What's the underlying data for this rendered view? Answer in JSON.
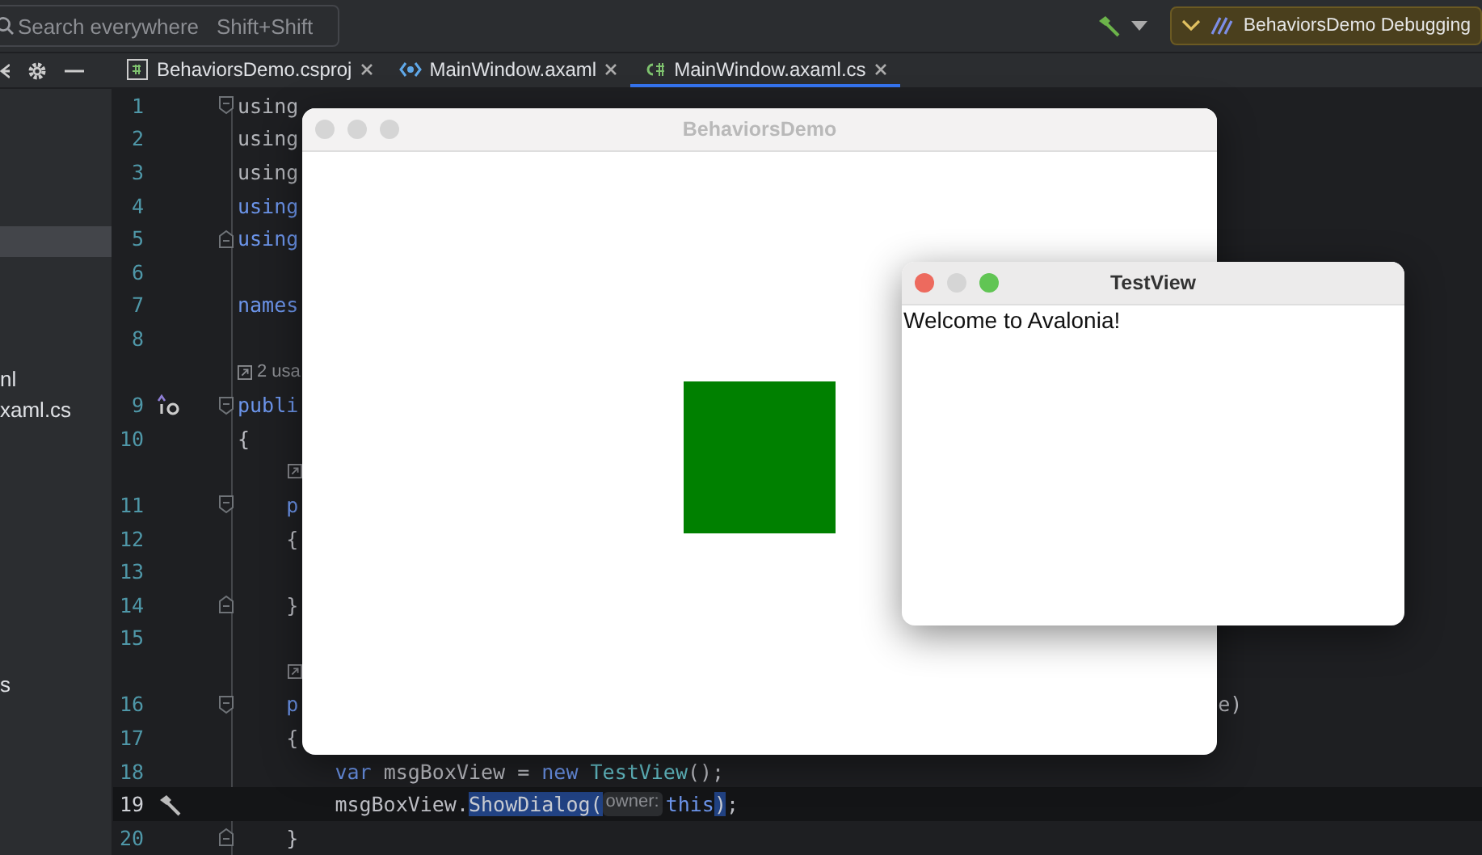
{
  "toolbar": {
    "search": {
      "placeholder": "Search everywhere",
      "shortcut": "Shift+Shift"
    },
    "run_config": {
      "label": "BehaviorsDemo Debugging"
    }
  },
  "tabs": [
    {
      "label": "BehaviorsDemo.csproj",
      "kind": "csproj",
      "selected": false
    },
    {
      "label": "MainWindow.axaml",
      "kind": "axaml",
      "selected": false
    },
    {
      "label": "MainWindow.axaml.cs",
      "kind": "cs",
      "selected": true
    }
  ],
  "sidebar": {
    "items": [
      {
        "selected": true
      },
      {
        "label": "nl",
        "selected": false
      },
      {
        "label": "xaml.cs",
        "selected": false
      },
      {
        "label": "s",
        "selected": false
      }
    ]
  },
  "editor": {
    "lines": [
      {
        "kind": "code",
        "number": "1",
        "current": false,
        "fold": {
          "kind": "start"
        },
        "parts": [
          {
            "text": "using",
            "kind": "dim"
          }
        ]
      },
      {
        "kind": "code",
        "number": "2",
        "current": false,
        "parts": [
          {
            "text": "using",
            "kind": "dim"
          }
        ]
      },
      {
        "kind": "code",
        "number": "3",
        "current": false,
        "parts": [
          {
            "text": "using",
            "kind": "dim"
          }
        ]
      },
      {
        "kind": "code",
        "number": "4",
        "current": false,
        "parts": [
          {
            "text": "using",
            "kind": "keyword"
          }
        ]
      },
      {
        "kind": "code",
        "number": "5",
        "current": false,
        "fold": {
          "kind": "end"
        },
        "parts": [
          {
            "text": "using",
            "kind": "keyword"
          }
        ]
      },
      {
        "kind": "code",
        "number": "6",
        "current": false
      },
      {
        "kind": "code",
        "number": "7",
        "current": false,
        "parts": [
          {
            "text": "names",
            "kind": "keyword"
          }
        ]
      },
      {
        "kind": "code",
        "number": "8",
        "current": false
      },
      {
        "kind": "inlay",
        "nested": false,
        "text": "2 usa"
      },
      {
        "kind": "code",
        "number": "9",
        "current": false,
        "fold": {
          "kind": "start"
        },
        "gutter_icon": {
          "kind": "implements"
        },
        "parts": [
          {
            "text": "publi",
            "kind": "keyword"
          }
        ]
      },
      {
        "kind": "code",
        "number": "10",
        "current": false,
        "parts": [
          {
            "text": "{",
            "kind": "plain"
          }
        ]
      },
      {
        "kind": "inlay",
        "nested": true
      },
      {
        "kind": "code",
        "number": "11",
        "current": false,
        "fold": {
          "kind": "start"
        },
        "parts": [
          {
            "text": "    p",
            "kind": "keyword"
          }
        ]
      },
      {
        "kind": "code",
        "number": "12",
        "current": false,
        "parts": [
          {
            "text": "    {",
            "kind": "plain"
          }
        ]
      },
      {
        "kind": "code",
        "number": "13",
        "current": false
      },
      {
        "kind": "code",
        "number": "14",
        "current": false,
        "fold": {
          "kind": "end"
        },
        "parts": [
          {
            "text": "    }",
            "kind": "plain"
          }
        ]
      },
      {
        "kind": "code",
        "number": "15",
        "current": false
      },
      {
        "kind": "inlay",
        "nested": true
      },
      {
        "kind": "code",
        "number": "16",
        "current": false,
        "fold": {
          "kind": "start"
        },
        "parts": [
          {
            "text": "    p",
            "kind": "keyword"
          },
          {
            "text": "e)",
            "kind": "tail"
          }
        ]
      },
      {
        "kind": "code",
        "number": "17",
        "current": false,
        "parts": [
          {
            "text": "    {",
            "kind": "plain"
          }
        ]
      },
      {
        "kind": "code",
        "number": "18",
        "current": false,
        "parts": [
          {
            "text": "        var",
            "kind": "keyword"
          },
          {
            "text": " msgBoxView = ",
            "kind": "plain"
          },
          {
            "text": "new ",
            "kind": "keyword"
          },
          {
            "text": "TestView",
            "kind": "type"
          },
          {
            "text": "();",
            "kind": "plain"
          }
        ]
      },
      {
        "kind": "code",
        "number": "19",
        "current": true,
        "gutter_icon": {
          "kind": "hammer"
        },
        "parts": [
          {
            "text": "        msgBoxView.",
            "kind": "plain"
          },
          {
            "text": "ShowDialog(",
            "kind": "selection"
          },
          {
            "text": "owner:",
            "kind": "hint"
          },
          {
            "text": "this",
            "kind": "keyword"
          },
          {
            "text": ")",
            "kind": "selection"
          },
          {
            "text": ";",
            "kind": "plain"
          }
        ]
      },
      {
        "kind": "code",
        "number": "20",
        "current": false,
        "fold": {
          "kind": "end"
        },
        "parts": [
          {
            "text": "    }",
            "kind": "plain"
          }
        ]
      }
    ]
  },
  "windows": [
    {
      "title": "BehaviorsDemo",
      "active": false,
      "kind": "main"
    },
    {
      "title": "TestView",
      "active": true,
      "kind": "dialog",
      "text": "Welcome to Avalonia!"
    }
  ]
}
